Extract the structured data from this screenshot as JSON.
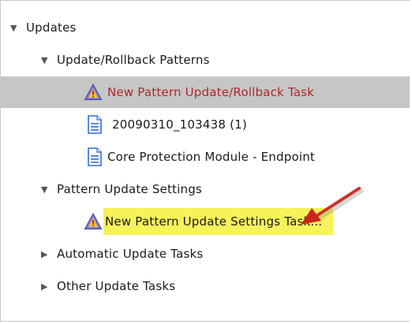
{
  "tree": {
    "updates": {
      "label": "Updates",
      "toggle": "▼"
    },
    "rollback_patterns": {
      "label": "Update/Rollback Patterns",
      "toggle": "▼"
    },
    "new_pattern_task": {
      "label": "New Pattern Update/Rollback Task",
      "icon": "warning-task-icon"
    },
    "pattern_20090310": {
      "label": "20090310_103438 (1)",
      "icon": "document-icon"
    },
    "core_protection": {
      "label": "Core Protection Module - Endpoint",
      "icon": "document-icon"
    },
    "pattern_update_settings": {
      "label": "Pattern Update Settings",
      "toggle": "▼"
    },
    "new_settings_task": {
      "label": "New Pattern Update Settings Task...",
      "icon": "warning-task-icon"
    },
    "automatic_update_tasks": {
      "label": "Automatic Update Tasks",
      "toggle": "▶"
    },
    "other_update_tasks": {
      "label": "Other Update Tasks",
      "toggle": "▶"
    }
  },
  "colors": {
    "selected_row": "#c6c6c6",
    "task_text_red": "#b0262a",
    "highlight_yellow": "#f6f25a",
    "arrow_red": "#d42a1e"
  }
}
